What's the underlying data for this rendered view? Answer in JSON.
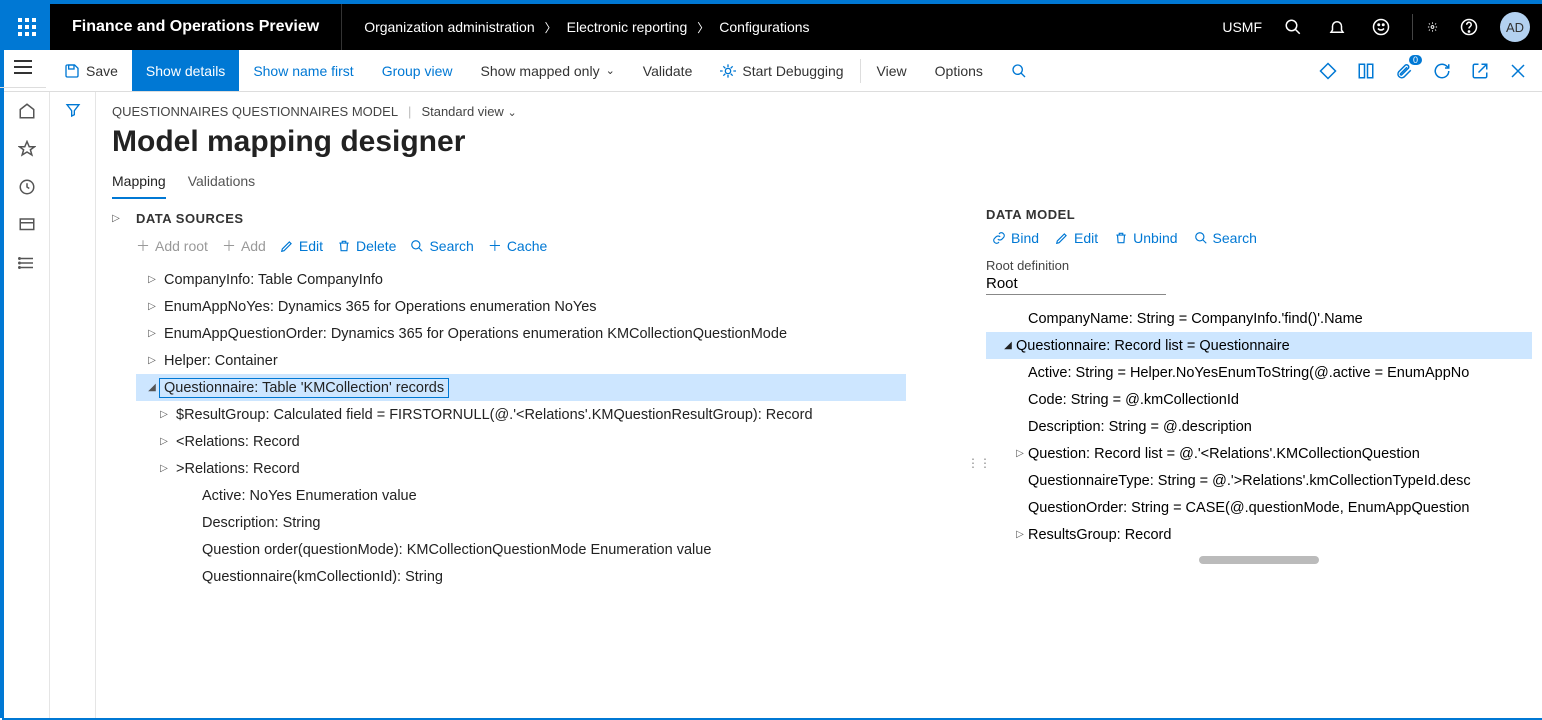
{
  "header": {
    "app_title": "Finance and Operations Preview",
    "breadcrumb": [
      "Organization administration",
      "Electronic reporting",
      "Configurations"
    ],
    "company": "USMF",
    "avatar": "AD"
  },
  "commandbar": {
    "save": "Save",
    "show_details": "Show details",
    "show_name_first": "Show name first",
    "group_view": "Group view",
    "show_mapped_only": "Show mapped only",
    "validate": "Validate",
    "start_debugging": "Start Debugging",
    "view": "View",
    "options": "Options"
  },
  "page": {
    "path": "QUESTIONNAIRES QUESTIONNAIRES MODEL",
    "standard_view": "Standard view",
    "title": "Model mapping designer"
  },
  "tabs": {
    "mapping": "Mapping",
    "validations": "Validations"
  },
  "datasources": {
    "title": "DATA SOURCES",
    "toolbar": {
      "add_root": "Add root",
      "add": "Add",
      "edit": "Edit",
      "delete": "Delete",
      "search": "Search",
      "cache": "Cache"
    },
    "tree": [
      {
        "level": 0,
        "arrow": "▷",
        "text": "CompanyInfo: Table CompanyInfo"
      },
      {
        "level": 0,
        "arrow": "▷",
        "text": "EnumAppNoYes: Dynamics 365 for Operations enumeration NoYes"
      },
      {
        "level": 0,
        "arrow": "▷",
        "text": "EnumAppQuestionOrder: Dynamics 365 for Operations enumeration KMCollectionQuestionMode"
      },
      {
        "level": 0,
        "arrow": "▷",
        "text": "Helper: Container"
      },
      {
        "level": 0,
        "arrow": "◢",
        "text": "Questionnaire: Table 'KMCollection' records",
        "selected": true
      },
      {
        "level": 1,
        "arrow": "▷",
        "text": "$ResultGroup: Calculated field = FIRSTORNULL(@.'<Relations'.KMQuestionResultGroup): Record"
      },
      {
        "level": 1,
        "arrow": "▷",
        "text": "<Relations: Record"
      },
      {
        "level": 1,
        "arrow": "▷",
        "text": ">Relations: Record"
      },
      {
        "level": 2,
        "arrow": "",
        "text": "Active: NoYes Enumeration value"
      },
      {
        "level": 2,
        "arrow": "",
        "text": "Description: String"
      },
      {
        "level": 2,
        "arrow": "",
        "text": "Question order(questionMode): KMCollectionQuestionMode Enumeration value"
      },
      {
        "level": 2,
        "arrow": "",
        "text": "Questionnaire(kmCollectionId): String"
      }
    ]
  },
  "datamodel": {
    "title": "DATA MODEL",
    "toolbar": {
      "bind": "Bind",
      "edit": "Edit",
      "unbind": "Unbind",
      "search": "Search"
    },
    "root_label": "Root definition",
    "root_value": "Root",
    "tree": [
      {
        "level": 1,
        "arrow": "",
        "text": "CompanyName: String = CompanyInfo.'find()'.Name"
      },
      {
        "level": 0,
        "arrow": "◢",
        "text": "Questionnaire: Record list = Questionnaire",
        "selected": true
      },
      {
        "level": 1,
        "arrow": "",
        "text": "Active: String = Helper.NoYesEnumToString(@.active = EnumAppNo"
      },
      {
        "level": 1,
        "arrow": "",
        "text": "Code: String = @.kmCollectionId"
      },
      {
        "level": 1,
        "arrow": "",
        "text": "Description: String = @.description"
      },
      {
        "level": 1,
        "arrow": "▷",
        "text": "Question: Record list = @.'<Relations'.KMCollectionQuestion"
      },
      {
        "level": 1,
        "arrow": "",
        "text": "QuestionnaireType: String = @.'>Relations'.kmCollectionTypeId.desc"
      },
      {
        "level": 1,
        "arrow": "",
        "text": "QuestionOrder: String = CASE(@.questionMode, EnumAppQuestion"
      },
      {
        "level": 1,
        "arrow": "▷",
        "text": "ResultsGroup: Record"
      }
    ]
  }
}
